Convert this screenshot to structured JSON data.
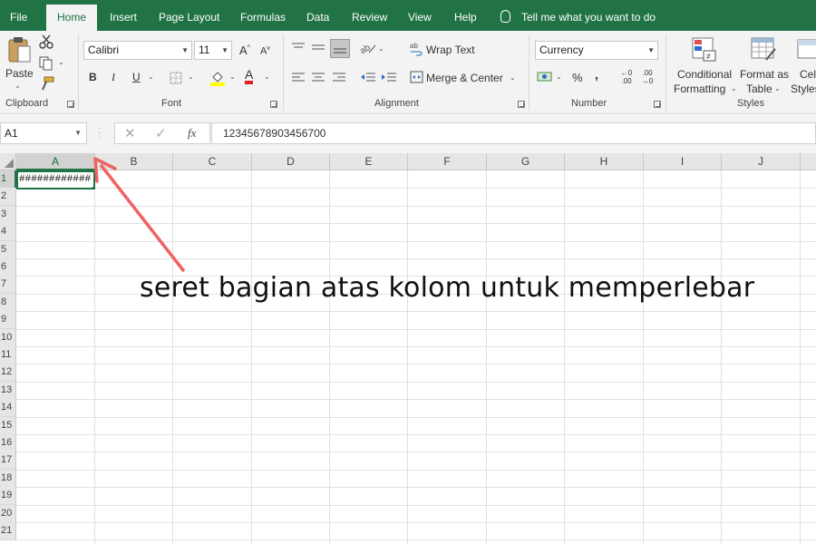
{
  "menu": {
    "tabs": [
      "File",
      "Home",
      "Insert",
      "Page Layout",
      "Formulas",
      "Data",
      "Review",
      "View",
      "Help"
    ],
    "active_tab": "Home",
    "tell_me": "Tell me what you want to do"
  },
  "ribbon": {
    "clipboard": {
      "paste_label": "Paste",
      "group_label": "Clipboard"
    },
    "font": {
      "font_name": "Calibri",
      "font_size": "11",
      "bold": "B",
      "italic": "I",
      "underline": "U",
      "grow": "A",
      "shrink": "A",
      "font_color": "A",
      "group_label": "Font"
    },
    "alignment": {
      "wrap_text": "Wrap Text",
      "merge_center": "Merge & Center",
      "group_label": "Alignment"
    },
    "number": {
      "format": "Currency",
      "percent": "%",
      "comma": ",",
      "inc_decimal": "←0 .00",
      "dec_decimal": ".00 →0",
      "group_label": "Number"
    },
    "styles": {
      "conditional_formatting": [
        "Conditional",
        "Formatting"
      ],
      "format_as_table": [
        "Format as",
        "Table"
      ],
      "cell_styles": [
        "Cell",
        "Styles"
      ],
      "group_label": "Styles"
    }
  },
  "formula_bar": {
    "name_box": "A1",
    "fx": "fx",
    "value": "12345678903456700"
  },
  "grid": {
    "columns": [
      "A",
      "B",
      "C",
      "D",
      "E",
      "F",
      "G",
      "H",
      "I",
      "J"
    ],
    "rows": [
      "1",
      "2",
      "3",
      "4",
      "5",
      "6",
      "7",
      "8",
      "9",
      "10",
      "11",
      "12",
      "13",
      "14",
      "15",
      "16",
      "17",
      "18",
      "19",
      "20",
      "21"
    ],
    "selected_cell": "A1",
    "cell_a1_display": "############"
  },
  "annotation": {
    "text": "seret bagian atas kolom untuk memperlebar",
    "arrow_color": "#f06262"
  },
  "colors": {
    "excel_green": "#217346",
    "ribbon_bg": "#f3f3f3"
  }
}
